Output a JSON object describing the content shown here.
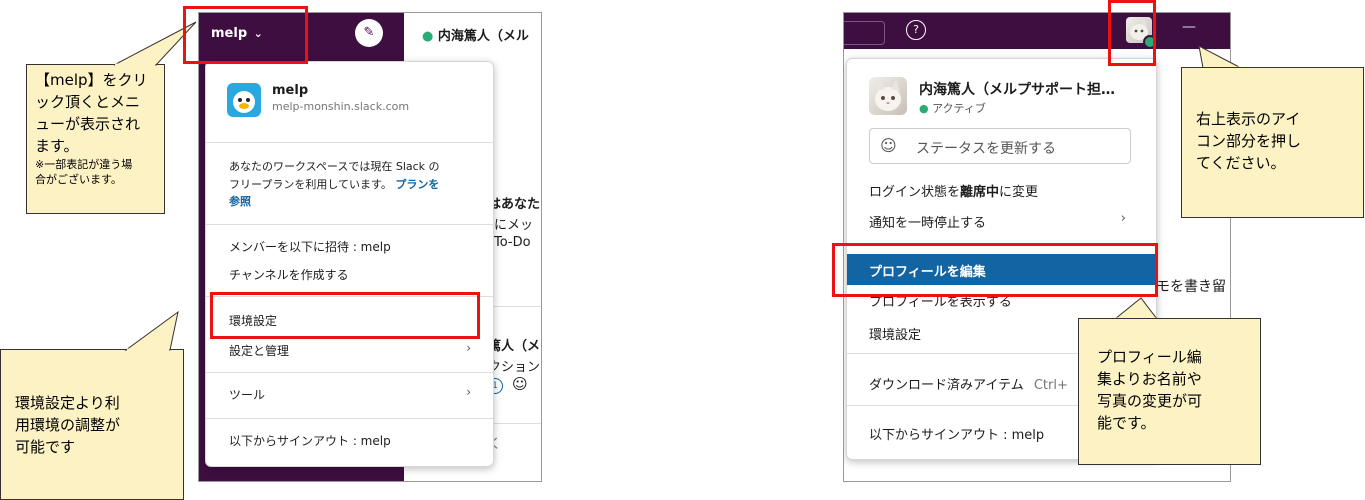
{
  "left_callouts": {
    "top": {
      "line1": "【melp】をクリ",
      "line2": "ック頂くとメニ",
      "line3": "ューが表示され",
      "line4": "ます。",
      "note_line1": "※一部表記が違う場",
      "note_line2": "合がございます。"
    },
    "bottom": {
      "line1": "環境設定より利",
      "line2": "用環境の調整が",
      "line3": "可能です"
    }
  },
  "left_app": {
    "workspace_label": "melp",
    "workspace_chevron": "⌄",
    "compose_icon": "✎",
    "channel_title": "内海篤人（メル",
    "bg_texts": [
      "はあなた",
      "にメッ",
      "To-Do",
      "篤人（メ",
      "クション",
      "1",
      "☺",
      "く"
    ],
    "menu": {
      "ws_name": "melp",
      "ws_domain": "melp-monshin.slack.com",
      "plan_line1": "あなたのワークスペースでは現在 Slack の",
      "plan_line2": "フリープランを利用しています。",
      "plan_link_part1": "プランを",
      "plan_link_part2": "参照",
      "invite": "メンバーを以下に招待 : melp",
      "create_channel": "チャンネルを作成する",
      "preferences": "環境設定",
      "settings_admin": "設定と管理",
      "tools": "ツール",
      "sign_out": "以下からサインアウト : melp",
      "chevron": "›"
    }
  },
  "right_app": {
    "help_icon": "?",
    "minimize_icon": "—",
    "menu": {
      "user_name": "内海篤人（メルプサポート担…",
      "active_status": "アクティブ",
      "status_placeholder": "ステータスを更新する",
      "set_away_prefix": "ログイン状態を",
      "set_away_bold": "離席中",
      "set_away_suffix": "に変更",
      "pause_notifications": "通知を一時停止する",
      "edit_profile": "プロフィールを編集",
      "view_profile": "プロフィールを表示する",
      "preferences": "環境設定",
      "downloads": "ダウンロード済みアイテム",
      "downloads_shortcut": "Ctrl+",
      "sign_out": "以下からサインアウト : melp",
      "chevron": "›"
    },
    "bg_text": "モを書き留"
  },
  "right_callouts": {
    "top": {
      "line1": "右上表示のアイ",
      "line2": "コン部分を押し",
      "line3": "てください。"
    },
    "bottom": {
      "line1": "プロフィール編",
      "line2": "集よりお名前や",
      "line3": "写真の変更が可",
      "line4": "能です。"
    }
  },
  "colors": {
    "sidebar": "#3f0e40",
    "highlight_red": "#ee1111",
    "menu_highlight": "#1264a3",
    "callout_bg": "#fdf2c4",
    "online_green": "#2bac76",
    "link_blue": "#1264a3"
  }
}
